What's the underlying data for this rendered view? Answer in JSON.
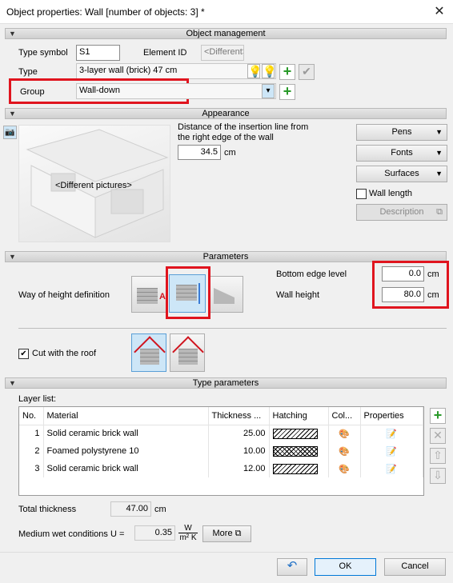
{
  "window": {
    "title": "Object properties: Wall [number of objects: 3] *"
  },
  "sections": {
    "object_management": "Object management",
    "appearance": "Appearance",
    "parameters": "Parameters",
    "type_parameters": "Type parameters"
  },
  "object_management": {
    "type_symbol_label": "Type symbol",
    "type_symbol_value": "S1",
    "element_id_label": "Element ID",
    "element_id_value": "<Different>",
    "type_label": "Type",
    "type_value": "3-layer wall (brick) 47 cm",
    "group_label": "Group",
    "group_value": "Wall-down"
  },
  "appearance": {
    "preview_text": "<Different pictures>",
    "insertion_label_1": "Distance of the insertion line from",
    "insertion_label_2": "the right edge of the wall",
    "insertion_value": "34.5",
    "insertion_unit": "cm",
    "pens": "Pens",
    "fonts": "Fonts",
    "surfaces": "Surfaces",
    "wall_length": "Wall length",
    "description": "Description"
  },
  "parameters": {
    "way_label": "Way of height definition",
    "bottom_label": "Bottom edge level",
    "bottom_value": "0.0",
    "bottom_unit": "cm",
    "height_label": "Wall height",
    "height_value": "80.0",
    "height_unit": "cm",
    "cut_roof": "Cut with the roof"
  },
  "type_parameters": {
    "layer_list_label": "Layer list:",
    "columns": [
      "No.",
      "Material",
      "Thickness ...",
      "Hatching",
      "Col...",
      "Properties"
    ],
    "rows": [
      {
        "no": "1",
        "material": "Solid ceramic brick wall",
        "thickness": "25.00"
      },
      {
        "no": "2",
        "material": "Foamed polystyrene 10",
        "thickness": "10.00"
      },
      {
        "no": "3",
        "material": "Solid ceramic brick wall",
        "thickness": "12.00"
      }
    ],
    "total_label": "Total thickness",
    "total_value": "47.00",
    "total_unit": "cm",
    "u_label": "Medium wet conditions U =",
    "u_value": "0.35",
    "u_unit_num": "W",
    "u_unit_den": "m² K",
    "more": "More"
  },
  "footer": {
    "ok": "OK",
    "cancel": "Cancel"
  },
  "colors": {
    "highlight": "#e0141e",
    "add": "#2a9a2a",
    "selected": "#cde6f7"
  }
}
